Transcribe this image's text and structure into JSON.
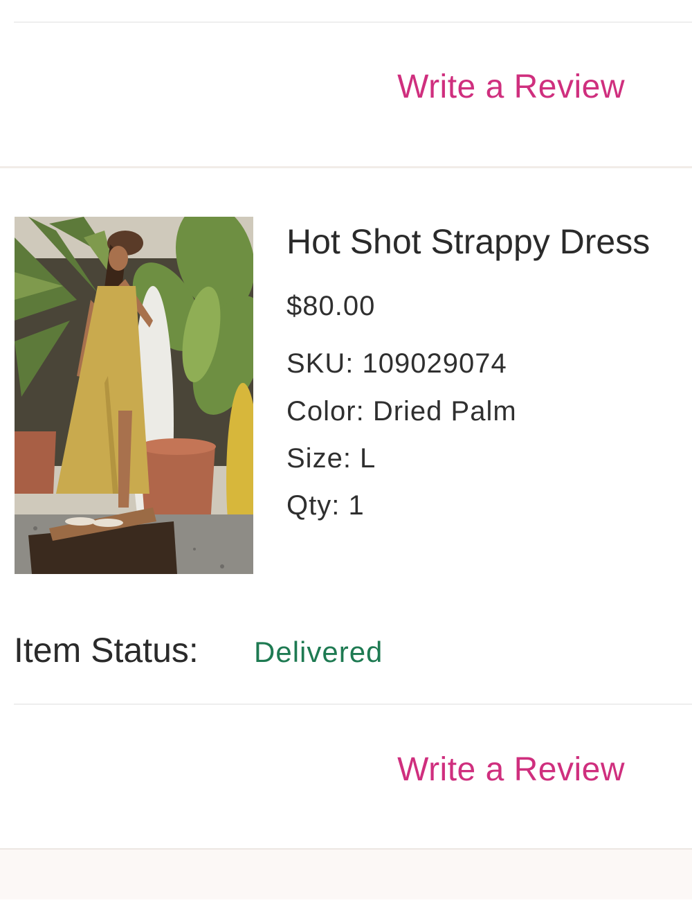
{
  "previous_item": {
    "write_review_label": "Write a Review"
  },
  "item": {
    "title": "Hot Shot Strappy Dress",
    "price": "$80.00",
    "sku": "SKU: 109029074",
    "color": "Color: Dried Palm",
    "size": "Size: L",
    "qty": "Qty: 1",
    "image_alt": "Hot Shot Strappy Dress product photo",
    "status_label": "Item Status:",
    "status_value": "Delivered",
    "write_review_label": "Write a Review"
  },
  "colors": {
    "accent_pink": "#cf2f7e",
    "status_green": "#1e7a52"
  }
}
